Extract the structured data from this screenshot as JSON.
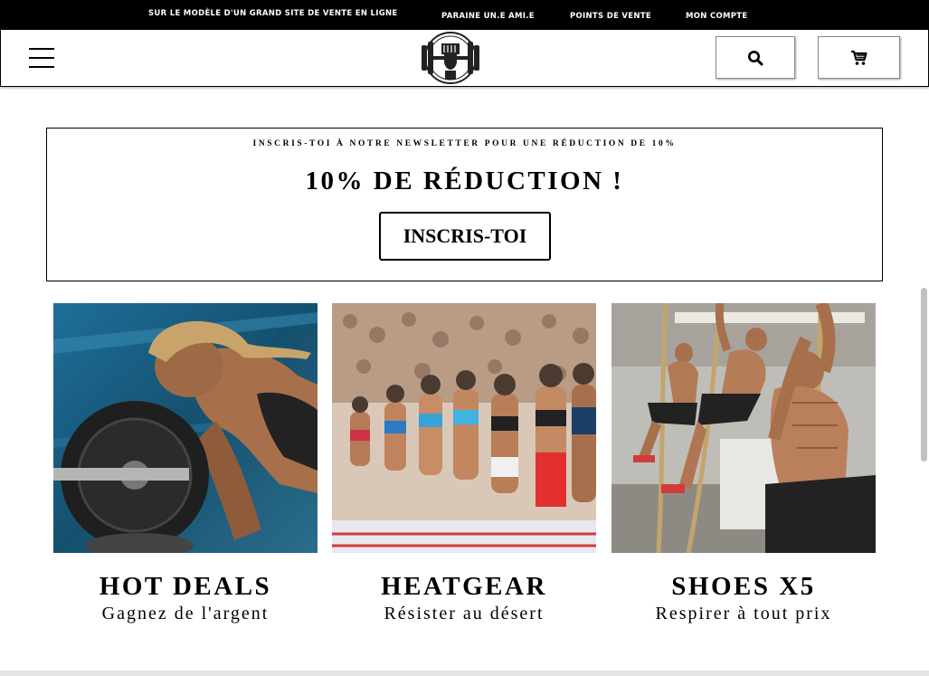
{
  "topnav": {
    "promo": "SUR LE MODÈLE D'UN GRAND SITE DE VENTE EN LIGNE",
    "referral": "PARAINE UN.E AMI.E",
    "stores": "POINTS DE VENTE",
    "account": "MON COMPTE"
  },
  "header": {
    "menu_icon": "hamburger-menu-icon",
    "logo_icon": "fist-barbell-logo",
    "search_icon": "search-icon",
    "cart_icon": "cart-icon"
  },
  "newsletter": {
    "subtitle": "INSCRIS-TOI À NOTRE NEWSLETTER POUR UNE RÉDUCTION DE 10%",
    "title": "10% DE RÉDUCTION !",
    "button": "INSCRIS-TOI"
  },
  "cards": [
    {
      "title": "HOT DEALS",
      "subtitle": "Gagnez de l'argent"
    },
    {
      "title": "HEATGEAR",
      "subtitle": "Résister au désert"
    },
    {
      "title": "SHOES X5",
      "subtitle": "Respirer à tout prix"
    }
  ],
  "colors": {
    "topbar": "#000000",
    "text": "#000000",
    "background": "#ffffff"
  }
}
